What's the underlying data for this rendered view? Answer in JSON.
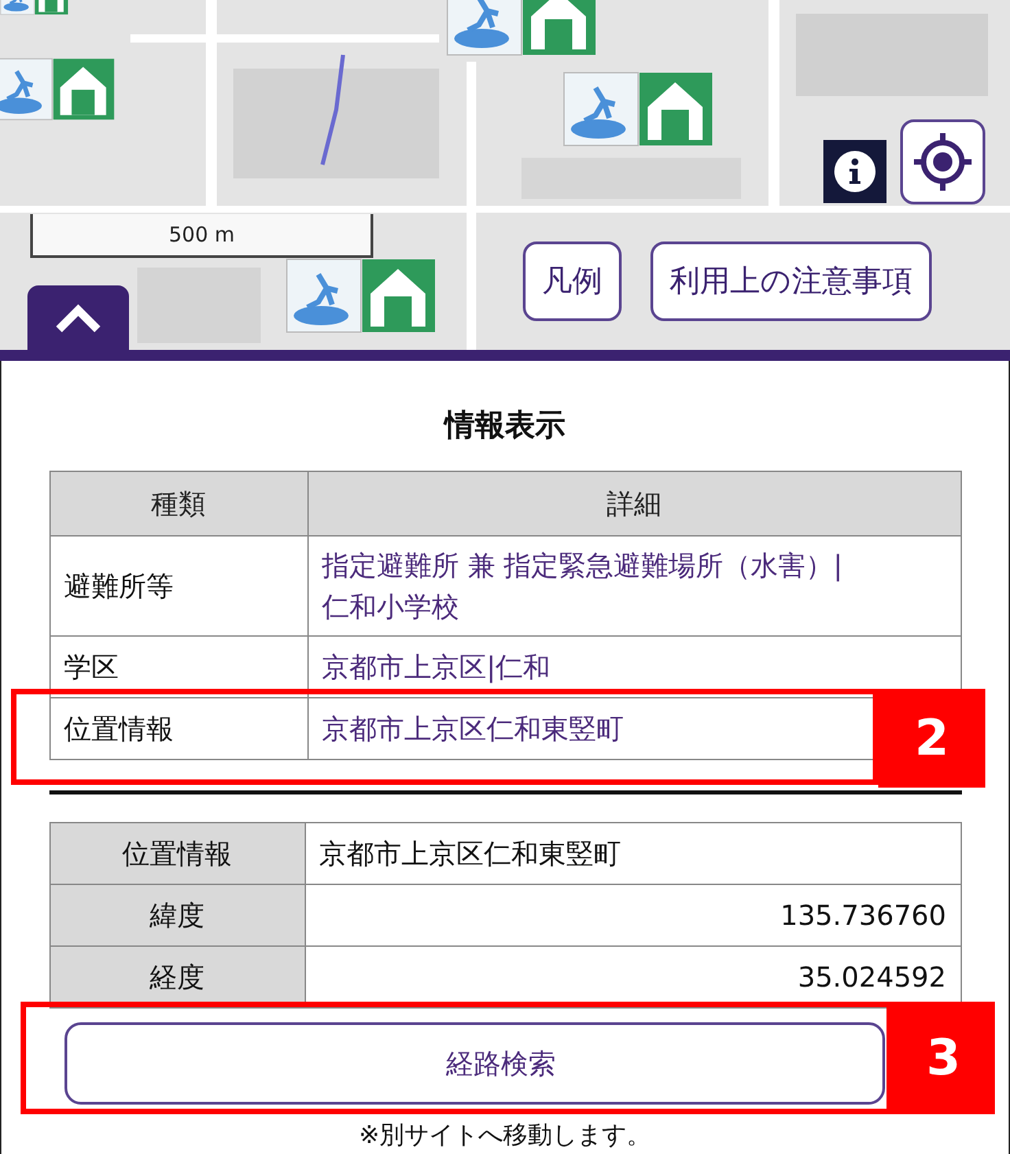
{
  "map": {
    "scale": "500 m",
    "buttons": [
      {
        "label": "凡例"
      },
      {
        "label": "利用上の注意事項"
      }
    ]
  },
  "panel": {
    "title": "情報表示",
    "info_table": {
      "columns": [
        "種類",
        "詳細"
      ],
      "rows": [
        {
          "type": "避難所等",
          "detail": [
            "指定避難所 兼 指定緊急避難場所（水害）|",
            "仁和小学校"
          ]
        },
        {
          "type": "学区",
          "detail": [
            "京都市上京区|仁和"
          ]
        },
        {
          "type": "位置情報",
          "detail": [
            "京都市上京区仁和東竪町"
          ]
        }
      ]
    },
    "location_table": [
      {
        "label": "位置情報",
        "value": "京都市上京区仁和東竪町",
        "kind": "text"
      },
      {
        "label": "緯度",
        "value": "135.736760",
        "kind": "number"
      },
      {
        "label": "経度",
        "value": "35.024592",
        "kind": "number"
      }
    ],
    "route_button": "経路検索",
    "note": "※別サイトへ移動します。"
  },
  "annotations": [
    {
      "number": "2"
    },
    {
      "number": "3"
    }
  ]
}
